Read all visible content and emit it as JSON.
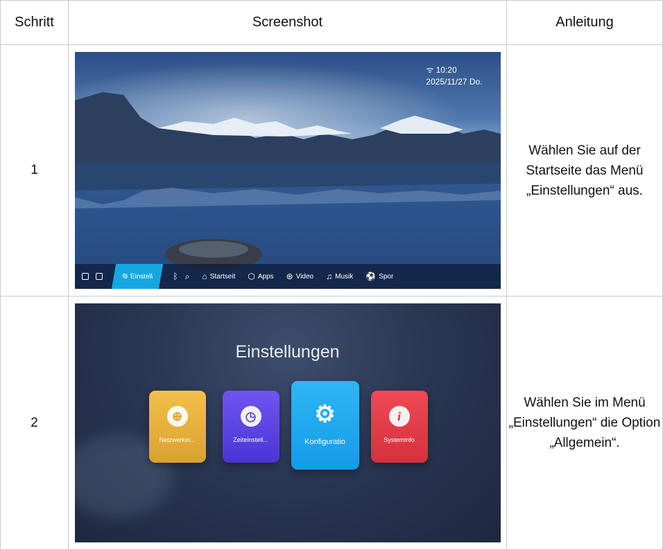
{
  "table": {
    "headers": [
      "Schritt",
      "Screenshot",
      "Anleitung"
    ],
    "rows": [
      {
        "step": "1",
        "instruction": "Wählen Sie auf der Startseite das Menü „Einstellungen“ aus.",
        "screen": {
          "time": "10:20",
          "date": "2025/11/27 Do.",
          "taskbar": {
            "active": "Einstell",
            "items": [
              "Startseit",
              "Apps",
              "Video",
              "Musik",
              "Spor"
            ]
          }
        }
      },
      {
        "step": "2",
        "instruction": "Wählen Sie im Menü „Einstellungen“ die Option „Allgemein“.",
        "screen": {
          "title": "Einstellungen",
          "tiles": [
            "Netzwerkei...",
            "Zeiteinstell...",
            "Konfiguratio",
            "Systeminfo"
          ]
        }
      }
    ]
  },
  "icons": [
    "wifi-icon",
    "gear-icon",
    "search-icon",
    "home-icon",
    "apps-icon",
    "video-icon",
    "music-icon",
    "sport-icon",
    "globe-icon",
    "clock-icon",
    "info-icon"
  ]
}
